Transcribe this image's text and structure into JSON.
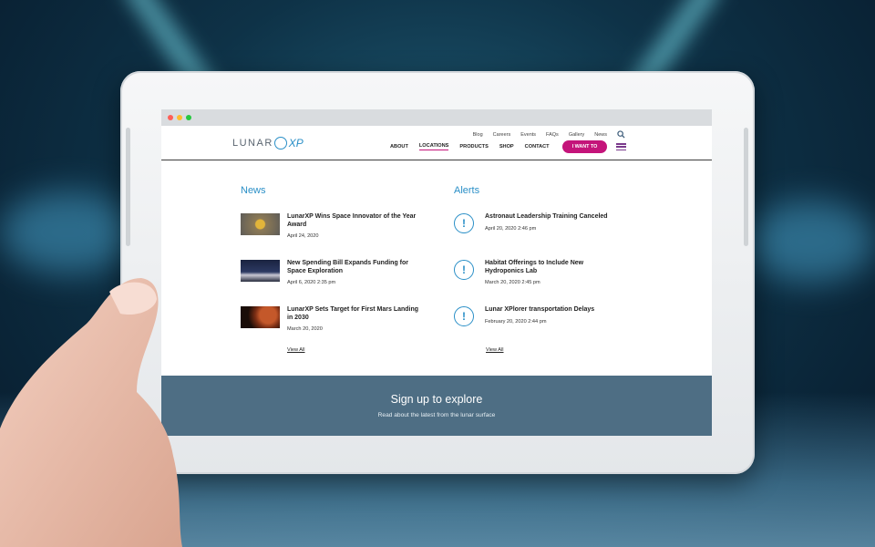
{
  "browser": {
    "dots": [
      "#ff5f57",
      "#febc2e",
      "#28c840"
    ]
  },
  "header": {
    "logo": {
      "text": "LUNAR",
      "x_mark": "XP"
    },
    "utility_nav": [
      "Blog",
      "Careers",
      "Events",
      "FAQs",
      "Gallery",
      "News"
    ],
    "main_nav": [
      "ABOUT",
      "LOCATIONS",
      "PRODUCTS",
      "SHOP",
      "CONTACT"
    ],
    "active_nav": "LOCATIONS",
    "cta_label": "I WANT TO"
  },
  "news": {
    "title": "News",
    "items": [
      {
        "title": "LunarXP Wins Space Innovator of the Year Award",
        "date": "April 24, 2020"
      },
      {
        "title": "New Spending Bill Expands Funding for Space Exploration",
        "date": "April 6, 2020 2:35 pm"
      },
      {
        "title": "LunarXP Sets Target for First Mars Landing in 2030",
        "date": "March 20, 2020"
      }
    ],
    "view_all": "View All"
  },
  "alerts": {
    "title": "Alerts",
    "items": [
      {
        "title": "Astronaut Leadership Training Canceled",
        "date": "April 20, 2020 2:46 pm"
      },
      {
        "title": "Habitat Offerings to Include New Hydroponics Lab",
        "date": "March 20, 2020 2:45 pm"
      },
      {
        "title": "Lunar XPlorer transportation Delays",
        "date": "February 20, 2020 2:44 pm"
      }
    ],
    "view_all": "View All"
  },
  "signup": {
    "title": "Sign up to explore",
    "subtitle": "Read about the latest from the lunar surface"
  },
  "colors": {
    "accent": "#2a8fc7",
    "cta": "#c4147a",
    "signup_bg": "#4e6e84"
  }
}
